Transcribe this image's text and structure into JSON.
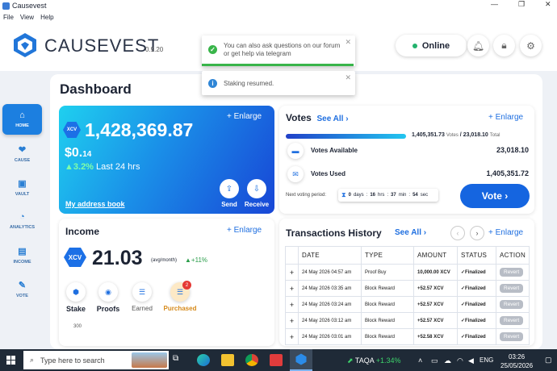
{
  "window": {
    "title": "Causevest"
  },
  "menu": [
    "File",
    "View",
    "Help"
  ],
  "header": {
    "brand": "CAUSEVEST",
    "version": "0.9.20",
    "status": "Online"
  },
  "toasts": [
    {
      "text": "You can also ask questions on our forum or get help via telegram",
      "type": "success"
    },
    {
      "text": "Staking resumed.",
      "type": "info"
    }
  ],
  "sidebar": {
    "items": [
      {
        "label": "HOME",
        "active": true,
        "icon": "home-icon"
      },
      {
        "label": "CAUSE",
        "icon": "cause-icon"
      },
      {
        "label": "VAULT",
        "icon": "vault-icon"
      },
      {
        "label": "ANALYTICS",
        "icon": "analytics-icon"
      },
      {
        "label": "INCOME",
        "icon": "income-icon"
      },
      {
        "label": "VOTE",
        "icon": "vote-icon"
      }
    ]
  },
  "dashboard": {
    "title": "Dashboard"
  },
  "balance": {
    "coin": "XCV",
    "amount": "1,428,369.87",
    "usd_main": "$0.",
    "usd_decimals": "14",
    "change_pct": "3.2%",
    "change_period": "Last 24 hrs",
    "enlarge": "Enlarge",
    "address_book": "My address book",
    "send": "Send",
    "receive": "Receive"
  },
  "votes": {
    "title": "Votes",
    "see_all": "See All",
    "enlarge": "Enlarge",
    "votes_value": "1,405,351.73",
    "votes_word": "Votes",
    "total_value": "23,018.10",
    "total_word": "Total",
    "progress_fraction": 0.98,
    "available_label": "Votes Available",
    "available_value": "23,018.10",
    "used_label": "Votes Used",
    "used_value": "1,405,351.72",
    "next_period_label": "Next voting period:",
    "days": "0",
    "days_unit": "days",
    "hrs": "16",
    "hrs_unit": "hrs",
    "min": "37",
    "min_unit": "min",
    "sec": "54",
    "sec_unit": "sec",
    "vote_button": "Vote"
  },
  "income": {
    "title": "Income",
    "enlarge": "Enlarge",
    "coin": "XCV",
    "amount": "21.03",
    "unit": "(avg/month)",
    "pct": "+11%",
    "tabs": [
      "Stake",
      "Proofs",
      "Earned",
      "Purchased"
    ],
    "badge": "2",
    "axis_tick": "300"
  },
  "transactions": {
    "title": "Transactions History",
    "see_all": "See All",
    "enlarge": "Enlarge",
    "columns": [
      "DATE",
      "TYPE",
      "AMOUNT",
      "STATUS",
      "ACTION"
    ],
    "rows": [
      {
        "date": "24 May 2026 04:57 am",
        "type": "Proof Buy",
        "amount": "10,000.00 XCV",
        "status": "Finalized",
        "action": "Revert"
      },
      {
        "date": "24 May 2026 03:35 am",
        "type": "Block Reward",
        "amount": "+52.57 XCV",
        "status": "Finalized",
        "action": "Revert"
      },
      {
        "date": "24 May 2026 03:24 am",
        "type": "Block Reward",
        "amount": "+52.57 XCV",
        "status": "Finalized",
        "action": "Revert"
      },
      {
        "date": "24 May 2026 03:12 am",
        "type": "Block Reward",
        "amount": "+52.57 XCV",
        "status": "Finalized",
        "action": "Revert"
      },
      {
        "date": "24 May 2026 03:01 am",
        "type": "Block Reward",
        "amount": "+52.58 XCV",
        "status": "Finalized",
        "action": "Revert"
      }
    ]
  },
  "taskbar": {
    "search_placeholder": "Type here to search",
    "ticker": "TAQA",
    "ticker_change": "+1.34%",
    "lang": "ENG",
    "time": "03:26",
    "date": "25/05/2026"
  },
  "colors": {
    "accent": "#1565e0",
    "success": "#2e9e46",
    "online": "#23b26d"
  }
}
